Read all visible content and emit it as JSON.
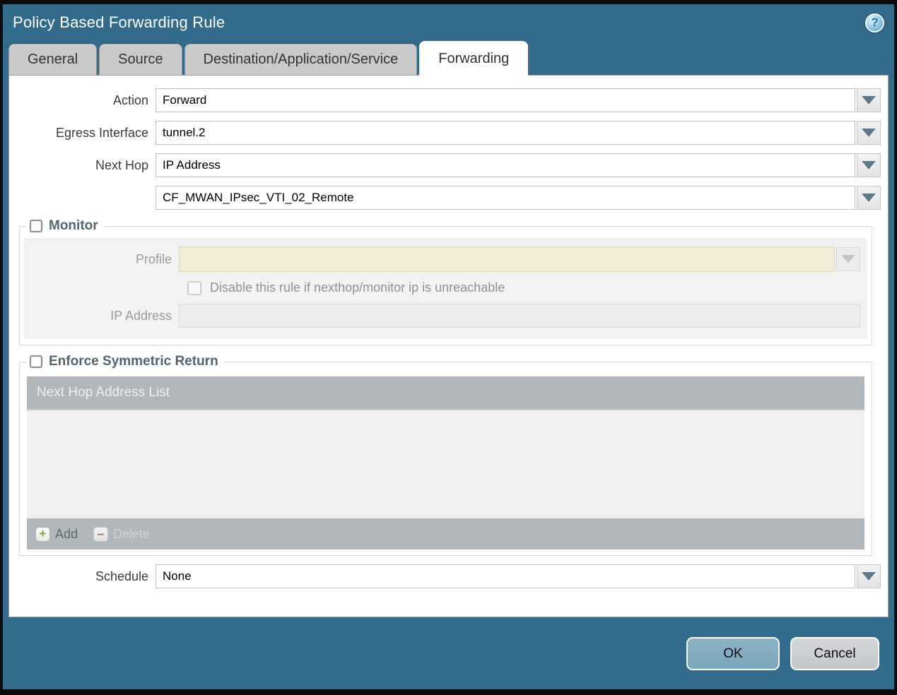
{
  "window": {
    "title": "Policy Based Forwarding Rule",
    "help_glyph": "?"
  },
  "tabs": [
    {
      "label": "General",
      "active": false
    },
    {
      "label": "Source",
      "active": false
    },
    {
      "label": "Destination/Application/Service",
      "active": false
    },
    {
      "label": "Forwarding",
      "active": true
    }
  ],
  "form": {
    "action": {
      "label": "Action",
      "value": "Forward"
    },
    "egress_interface": {
      "label": "Egress Interface",
      "value": "tunnel.2"
    },
    "next_hop": {
      "label": "Next Hop",
      "value": "IP Address"
    },
    "next_hop_address": {
      "value": "CF_MWAN_IPsec_VTI_02_Remote"
    },
    "schedule": {
      "label": "Schedule",
      "value": "None"
    }
  },
  "monitor": {
    "title": "Monitor",
    "checked": false,
    "profile": {
      "label": "Profile",
      "value": ""
    },
    "disable_rule_label": "Disable this rule if nexthop/monitor ip is unreachable",
    "ip_address": {
      "label": "IP Address",
      "value": ""
    }
  },
  "symmetric_return": {
    "title": "Enforce Symmetric Return",
    "checked": false,
    "table": {
      "header": "Next Hop Address List",
      "rows": []
    },
    "add_label": "Add",
    "delete_label": "Delete"
  },
  "buttons": {
    "ok": "OK",
    "cancel": "Cancel"
  },
  "colors": {
    "dialog_teal": "#326b8c",
    "ok_button": "#7fa9bc",
    "table_gray": "#b1b7ba",
    "disabled_beige": "#f2ecd7",
    "legend_text": "#53646f"
  }
}
